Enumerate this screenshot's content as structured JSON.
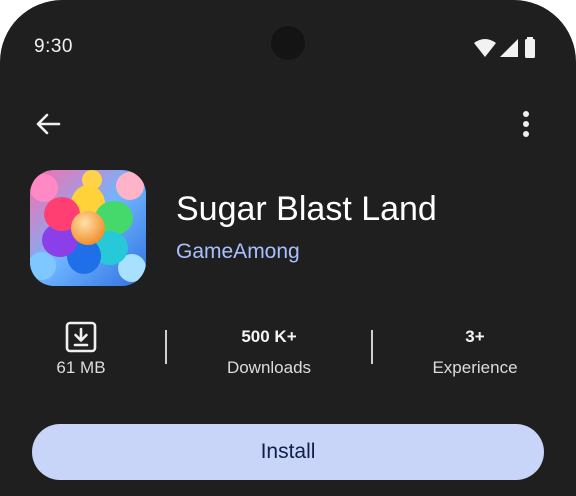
{
  "status_bar": {
    "time": "9:30",
    "icons": [
      "wifi-icon",
      "signal-icon",
      "battery-icon"
    ]
  },
  "toolbar": {
    "back_icon": "arrow-left-icon",
    "more_icon": "more-vert-icon"
  },
  "app": {
    "title": "Sugar Blast Land",
    "developer": "GameAmong"
  },
  "stats": {
    "size": {
      "value": "61 MB",
      "icon": "download-box-icon"
    },
    "downloads": {
      "value": "500 K+",
      "label": "Downloads"
    },
    "rating": {
      "value": "3+",
      "label": "Experience"
    }
  },
  "install_label": "Install",
  "colors": {
    "background": "#1f1f1f",
    "developer": "#a8c0ff",
    "install_bg": "#c9d5f8",
    "install_text": "#0e1f4a"
  }
}
